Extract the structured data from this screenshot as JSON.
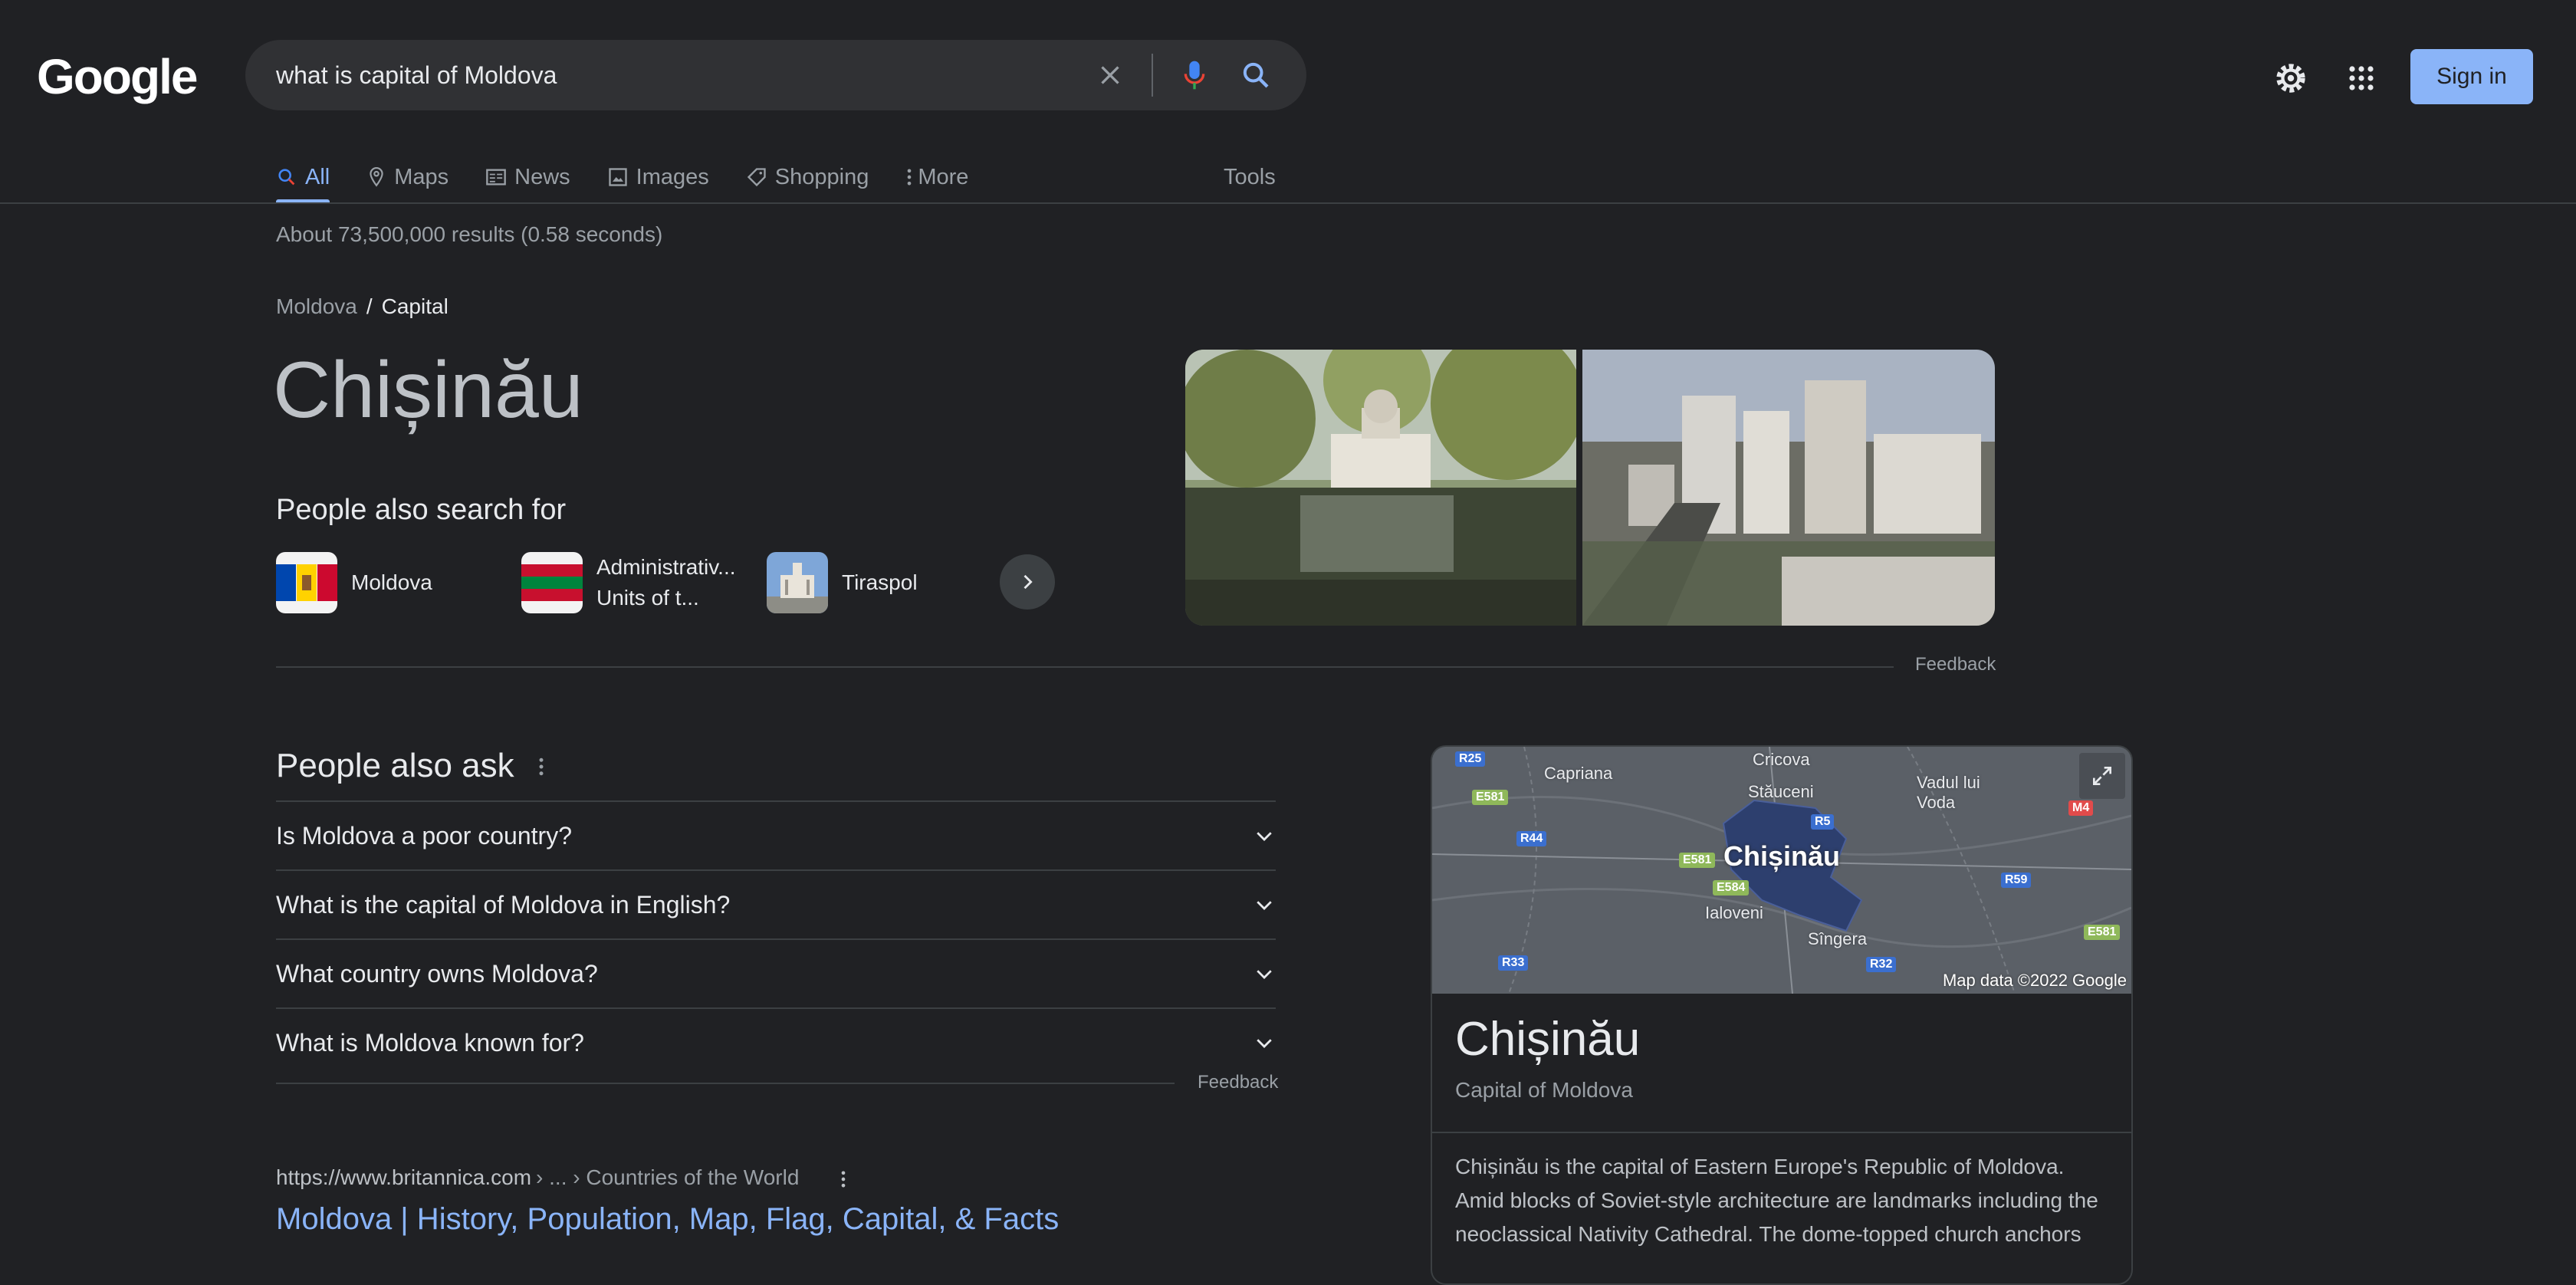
{
  "header": {
    "logo_text": "Google",
    "search_query": "what is capital of Moldova",
    "sign_in_label": "Sign in"
  },
  "tabs": [
    {
      "label": "All",
      "icon": "search-icon",
      "active": true
    },
    {
      "label": "Maps",
      "icon": "map-pin-icon"
    },
    {
      "label": "News",
      "icon": "news-icon"
    },
    {
      "label": "Images",
      "icon": "image-icon"
    },
    {
      "label": "Shopping",
      "icon": "tag-icon"
    },
    {
      "label": "More",
      "icon": "more-vert-icon"
    }
  ],
  "tools_label": "Tools",
  "result_stats": "About 73,500,000 results (0.58 seconds)",
  "breadcrumb": {
    "parent": "Moldova",
    "separator": "/",
    "current": "Capital"
  },
  "answer": "Chișinău",
  "people_also_search": {
    "title": "People also search for",
    "items": [
      {
        "label": "Moldova"
      },
      {
        "label": "Administrativ...\nUnits of t..."
      },
      {
        "label": "Tiraspol"
      }
    ]
  },
  "feedback_label": "Feedback",
  "people_also_ask": {
    "title": "People also ask",
    "questions": [
      "Is Moldova a poor country?",
      "What is the capital of Moldova in English?",
      "What country owns Moldova?",
      "What is Moldova known for?"
    ],
    "feedback": "Feedback"
  },
  "result": {
    "url_host": "https://www.britannica.com",
    "url_path": "› ... › Countries of the World",
    "title": "Moldova | History, Population, Map, Flag, Capital, & Facts"
  },
  "knowledge_panel": {
    "title": "Chișinău",
    "subtitle": "Capital of Moldova",
    "description": "Chișinău is the capital of Eastern Europe's Republic of Moldova. Amid blocks of Soviet-style architecture are landmarks including the neoclassical Nativity Cathedral. The dome-topped church anchors",
    "map": {
      "city": "Chișinău",
      "copyright": "Map data ©2022 Google",
      "places": [
        "Cricova",
        "Capriana",
        "Vadul lui Voda",
        "Stăuceni",
        "Ialoveni",
        "Sîngera"
      ],
      "roads": [
        "R25",
        "E581",
        "R44",
        "R5",
        "M4",
        "E581",
        "E584",
        "R59",
        "R33",
        "R32",
        "E581"
      ]
    }
  },
  "colors": {
    "background": "#202124",
    "link": "#8ab4f8",
    "text": "#bdc1c6"
  }
}
